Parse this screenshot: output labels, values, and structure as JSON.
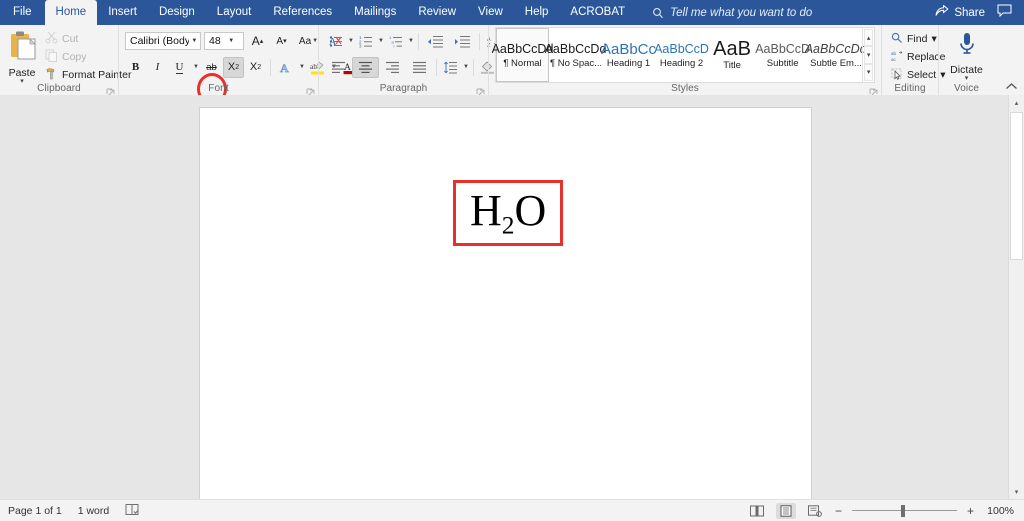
{
  "titlebar": {
    "tabs": [
      {
        "label": "File",
        "name": "tab-file",
        "active": false
      },
      {
        "label": "Home",
        "name": "tab-home",
        "active": true
      },
      {
        "label": "Insert",
        "name": "tab-insert",
        "active": false
      },
      {
        "label": "Design",
        "name": "tab-design",
        "active": false
      },
      {
        "label": "Layout",
        "name": "tab-layout",
        "active": false
      },
      {
        "label": "References",
        "name": "tab-references",
        "active": false
      },
      {
        "label": "Mailings",
        "name": "tab-mailings",
        "active": false
      },
      {
        "label": "Review",
        "name": "tab-review",
        "active": false
      },
      {
        "label": "View",
        "name": "tab-view",
        "active": false
      },
      {
        "label": "Help",
        "name": "tab-help",
        "active": false
      },
      {
        "label": "ACROBAT",
        "name": "tab-acrobat",
        "active": false
      }
    ],
    "tellme_placeholder": "Tell me what you want to do",
    "tellme_icon": "search-icon",
    "share_label": "Share",
    "share_icon": "share-icon",
    "comments_icon": "comment-icon",
    "accent_color": "#2b579a"
  },
  "ribbon": {
    "collapse_icon": "chevron-up-icon",
    "groups": {
      "clipboard": {
        "label": "Clipboard",
        "paste": {
          "label": "Paste",
          "icon": "clipboard-icon",
          "caret": "▾"
        },
        "cut": {
          "label": "Cut",
          "icon": "scissors-icon",
          "disabled": true
        },
        "copy": {
          "label": "Copy",
          "icon": "copy-icon",
          "disabled": true
        },
        "format_painter": {
          "label": "Format Painter",
          "icon": "paintbrush-icon",
          "disabled": false
        },
        "dialog_launcher": "dialog-launcher-icon"
      },
      "font": {
        "label": "Font",
        "font_name": "Calibri (Body)",
        "font_size": "48",
        "grow_font": {
          "label": "A",
          "name": "grow-font-button"
        },
        "shrink_font": {
          "label": "A",
          "name": "shrink-font-button"
        },
        "change_case": {
          "label": "Aa",
          "name": "change-case-button"
        },
        "clear_formatting": {
          "label": "clear-formatting-icon"
        },
        "bold": {
          "label": "B"
        },
        "italic": {
          "label": "I"
        },
        "underline": {
          "label": "U"
        },
        "strikethrough": {
          "label": "ab"
        },
        "subscript": {
          "label": "X",
          "sub": "2",
          "active": true,
          "highlighted": true
        },
        "superscript": {
          "label": "X",
          "sup": "2",
          "active": false
        },
        "text_effects": {
          "label": "A",
          "name": "text-effects-button"
        },
        "highlight_color": {
          "label": "ab",
          "color": "#ffe600"
        },
        "font_color": {
          "label": "A",
          "color": "#c00000"
        },
        "dialog_launcher": "dialog-launcher-icon",
        "annotation_color": "#e8312a"
      },
      "paragraph": {
        "label": "Paragraph",
        "bullets": "bullets-icon",
        "numbering": "numbering-icon",
        "multilevel": "multilevel-list-icon",
        "decrease_indent": "decrease-indent-icon",
        "increase_indent": "increase-indent-icon",
        "sort": "sort-icon",
        "show_marks": "¶",
        "align_left": "align-left-icon",
        "align_center": "align-center-icon",
        "align_right": "align-right-icon",
        "justify": "justify-icon",
        "line_spacing": "line-spacing-icon",
        "shading": "shading-icon",
        "borders": "borders-icon",
        "active_alignment": "align_center",
        "dialog_launcher": "dialog-launcher-icon"
      },
      "styles": {
        "label": "Styles",
        "items": [
          {
            "preview": "AaBbCcDd",
            "name": "¶ Normal",
            "selected": true,
            "style": ""
          },
          {
            "preview": "AaBbCcDd",
            "name": "¶ No Spac...",
            "selected": false,
            "style": ""
          },
          {
            "preview": "AaBbCc",
            "name": "Heading 1",
            "selected": false,
            "style": "blue"
          },
          {
            "preview": "AaBbCcD",
            "name": "Heading 2",
            "selected": false,
            "style": "blue"
          },
          {
            "preview": "AaB",
            "name": "Title",
            "selected": false,
            "style": "big"
          },
          {
            "preview": "AaBbCcD",
            "name": "Subtitle",
            "selected": false,
            "style": "grey"
          },
          {
            "preview": "AaBbCcDd",
            "name": "Subtle Em...",
            "selected": false,
            "style": "ital"
          }
        ],
        "scroll_up": "▴",
        "scroll_down": "▾",
        "more": "▾",
        "dialog_launcher": "dialog-launcher-icon"
      },
      "editing": {
        "label": "Editing",
        "find": {
          "label": "Find",
          "icon": "search-icon",
          "caret": "▾"
        },
        "replace": {
          "label": "Replace",
          "icon": "replace-icon"
        },
        "select": {
          "label": "Select",
          "icon": "select-icon",
          "caret": "▾"
        }
      },
      "voice": {
        "label": "Voice",
        "dictate": {
          "label": "Dictate",
          "icon": "microphone-icon",
          "caret": "▾"
        }
      }
    }
  },
  "document": {
    "formula_prefix": "H",
    "formula_subscript": "2",
    "formula_suffix": "O",
    "annotation_color": "#e8312a",
    "page_background": "#ffffff",
    "canvas_background": "#e6e6e6"
  },
  "scrollbar": {
    "up_arrow": "▴",
    "down_arrow": "▾"
  },
  "status": {
    "page_indicator": "Page 1 of 1",
    "word_count": "1 word",
    "proofing_icon": "proofing-icon",
    "views": [
      {
        "name": "read-mode-view-button",
        "icon": "read-mode-icon",
        "active": false
      },
      {
        "name": "print-layout-view-button",
        "icon": "print-layout-icon",
        "active": true
      },
      {
        "name": "web-layout-view-button",
        "icon": "web-layout-icon",
        "active": false
      }
    ],
    "zoom_out": "−",
    "zoom_in": "+",
    "zoom_level": "100%"
  }
}
